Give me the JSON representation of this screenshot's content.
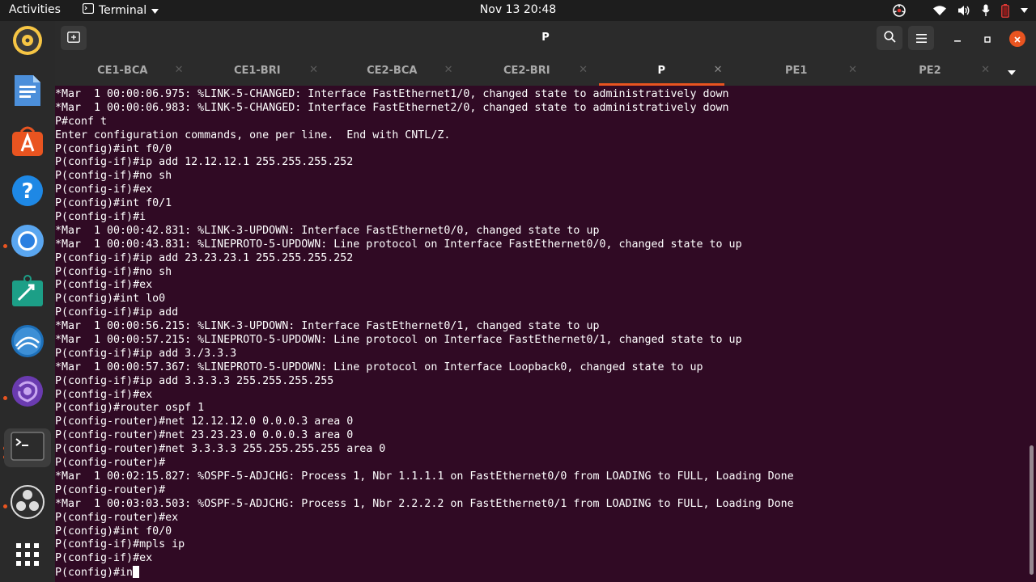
{
  "topbar": {
    "activities": "Activities",
    "app_name": "Terminal",
    "clock": "Nov 13  20:48"
  },
  "dock": {
    "items": [
      {
        "name": "rhythmbox-icon",
        "color": "#e8b830"
      },
      {
        "name": "libreoffice-writer-icon",
        "color": "#2d7bd3"
      },
      {
        "name": "ubuntu-software-icon",
        "color": "#e95420"
      },
      {
        "name": "help-icon",
        "color": "#1e88e5"
      },
      {
        "name": "chromium-icon",
        "color": "#2a8ee8"
      },
      {
        "name": "packet-tracer-icon",
        "color": "#1c9f87"
      },
      {
        "name": "wireshark-icon",
        "color": "#1d6fb8"
      },
      {
        "name": "gns3-icon",
        "color": "#6a3bb0"
      },
      {
        "name": "terminal-icon",
        "color": "#333333"
      },
      {
        "name": "obs-icon",
        "color": "#2f2f2f"
      },
      {
        "name": "show-applications-icon",
        "color": "#ffffff"
      }
    ]
  },
  "window": {
    "title": "P"
  },
  "tabs": [
    {
      "label": "CE1-BCA",
      "active": false
    },
    {
      "label": "CE1-BRI",
      "active": false
    },
    {
      "label": "CE2-BCA",
      "active": false
    },
    {
      "label": "CE2-BRI",
      "active": false
    },
    {
      "label": "P",
      "active": true
    },
    {
      "label": "PE1",
      "active": false
    },
    {
      "label": "PE2",
      "active": false
    }
  ],
  "terminal": {
    "lines": [
      "*Mar  1 00:00:06.975: %LINK-5-CHANGED: Interface FastEthernet1/0, changed state to administratively down",
      "*Mar  1 00:00:06.983: %LINK-5-CHANGED: Interface FastEthernet2/0, changed state to administratively down",
      "P#conf t",
      "Enter configuration commands, one per line.  End with CNTL/Z.",
      "P(config)#int f0/0",
      "P(config-if)#ip add 12.12.12.1 255.255.255.252",
      "P(config-if)#no sh",
      "P(config-if)#ex",
      "P(config)#int f0/1",
      "P(config-if)#i",
      "*Mar  1 00:00:42.831: %LINK-3-UPDOWN: Interface FastEthernet0/0, changed state to up",
      "*Mar  1 00:00:43.831: %LINEPROTO-5-UPDOWN: Line protocol on Interface FastEthernet0/0, changed state to up",
      "P(config-if)#ip add 23.23.23.1 255.255.255.252",
      "P(config-if)#no sh",
      "P(config-if)#ex",
      "P(config)#int lo0",
      "P(config-if)#ip add",
      "*Mar  1 00:00:56.215: %LINK-3-UPDOWN: Interface FastEthernet0/1, changed state to up",
      "*Mar  1 00:00:57.215: %LINEPROTO-5-UPDOWN: Line protocol on Interface FastEthernet0/1, changed state to up",
      "P(config-if)#ip add 3./3.3.3",
      "*Mar  1 00:00:57.367: %LINEPROTO-5-UPDOWN: Line protocol on Interface Loopback0, changed state to up",
      "P(config-if)#ip add 3.3.3.3 255.255.255.255",
      "P(config-if)#ex",
      "P(config)#router ospf 1",
      "P(config-router)#net 12.12.12.0 0.0.0.3 area 0",
      "P(config-router)#net 23.23.23.0 0.0.0.3 area 0",
      "P(config-router)#net 3.3.3.3 255.255.255.255 area 0",
      "P(config-router)#",
      "*Mar  1 00:02:15.827: %OSPF-5-ADJCHG: Process 1, Nbr 1.1.1.1 on FastEthernet0/0 from LOADING to FULL, Loading Done",
      "P(config-router)#",
      "*Mar  1 00:03:03.503: %OSPF-5-ADJCHG: Process 1, Nbr 2.2.2.2 on FastEthernet0/1 from LOADING to FULL, Loading Done",
      "P(config-router)#ex",
      "P(config)#int f0/0",
      "P(config-if)#mpls ip",
      "P(config-if)#ex"
    ],
    "prompt_line": "P(config)#in"
  },
  "colors": {
    "terminal_bg": "#300a24",
    "accent": "#e95420",
    "close_button": "#e95420"
  }
}
